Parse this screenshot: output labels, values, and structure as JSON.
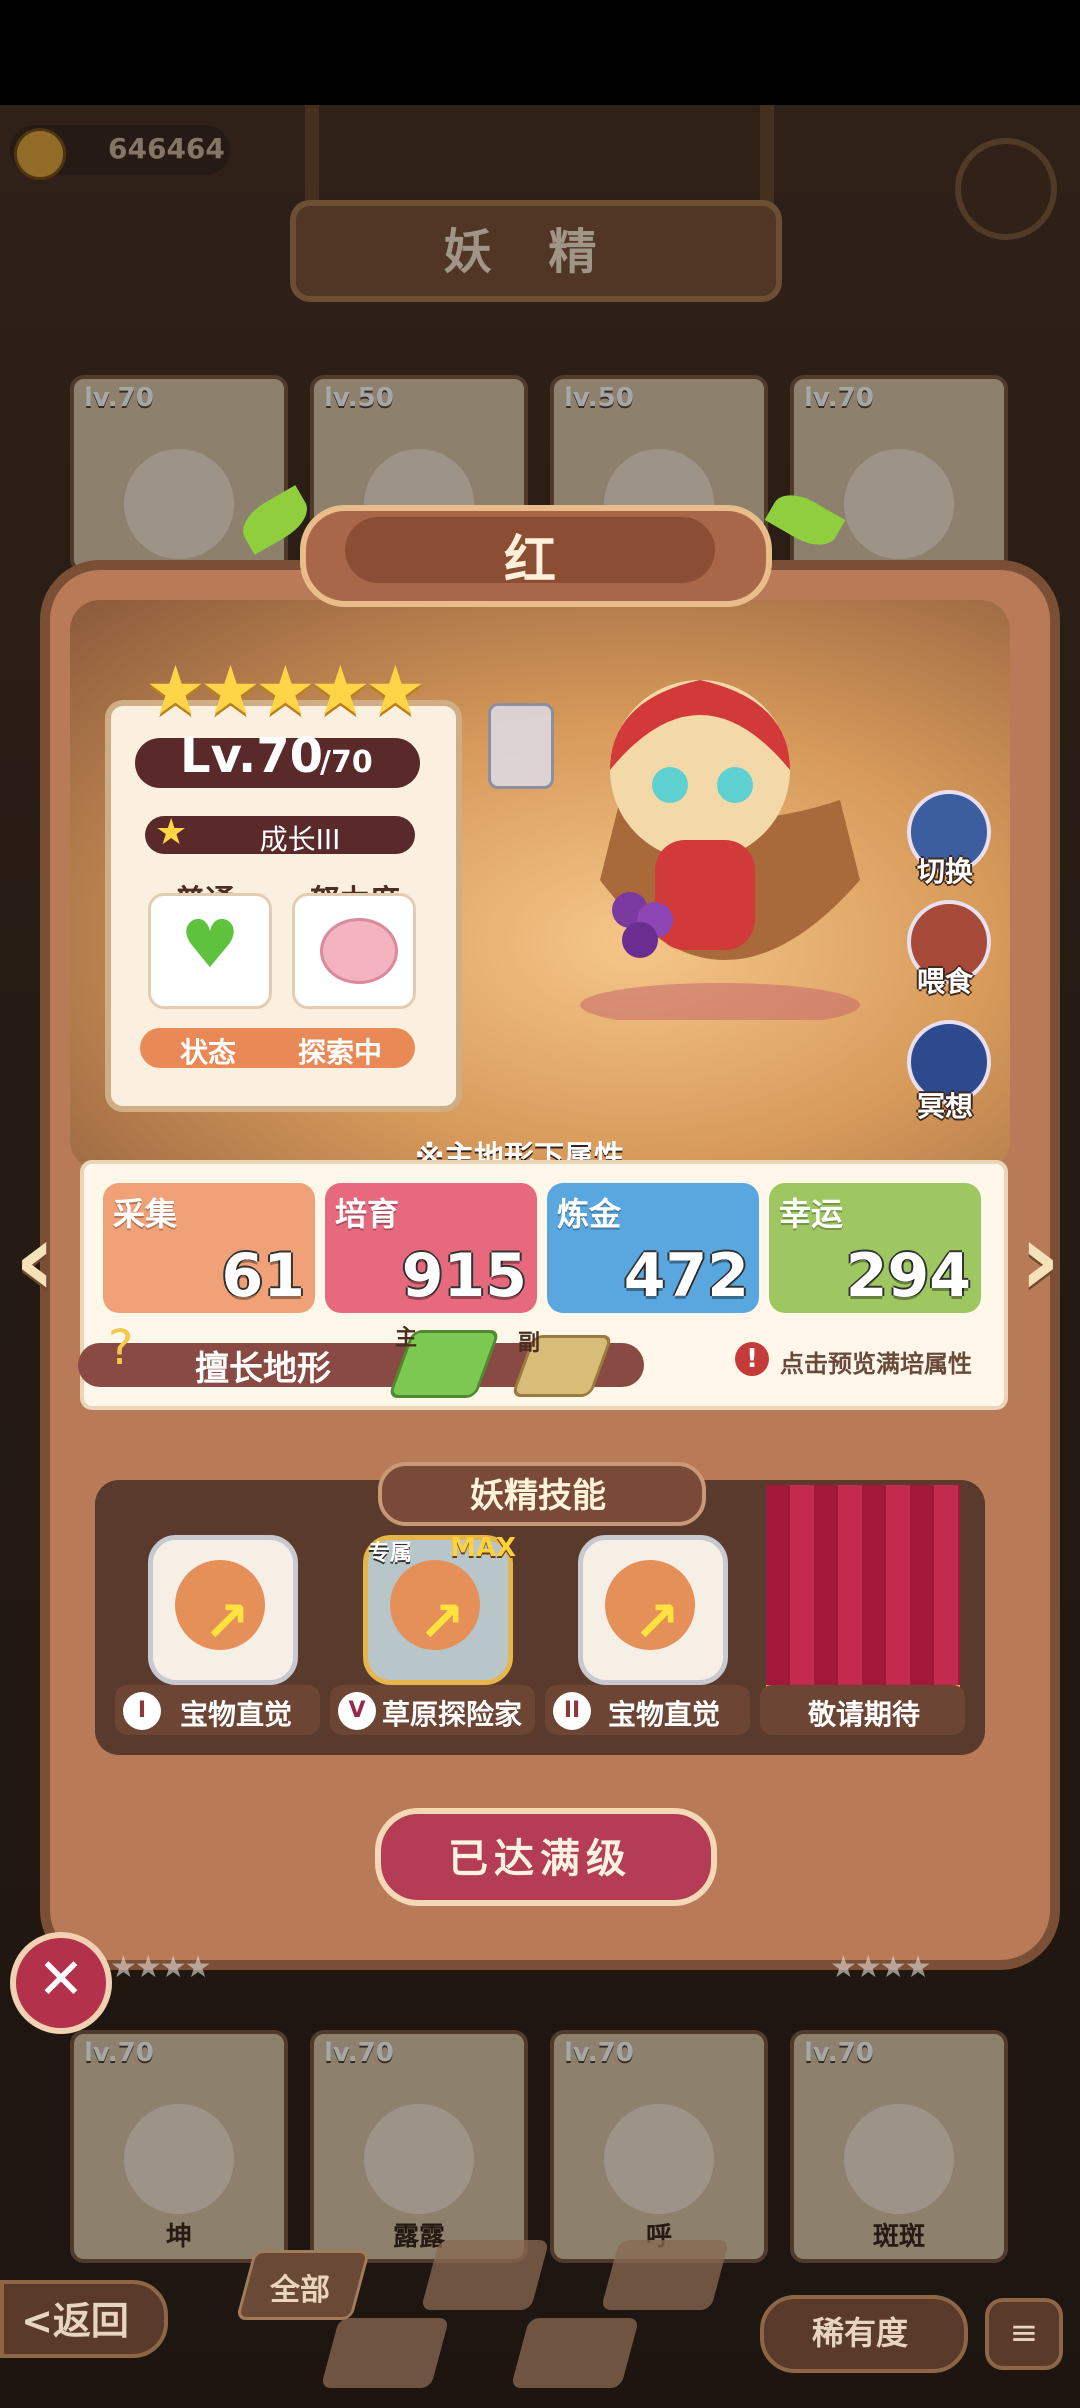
{
  "top": {
    "coin_count": "646464",
    "page_title": "妖 精"
  },
  "bg_cards_top": [
    {
      "level": "lv.70"
    },
    {
      "level": "lv.50"
    },
    {
      "level": "lv.50"
    },
    {
      "level": "lv.70"
    }
  ],
  "bg_cards_bottom": [
    {
      "level": "lv.70",
      "name": "坤"
    },
    {
      "level": "lv.70",
      "name": "露露"
    },
    {
      "level": "lv.70",
      "name": "呼"
    },
    {
      "level": "lv.70",
      "name": "斑斑"
    }
  ],
  "fairy": {
    "name": "红",
    "stars": "★★★★★",
    "level": "Lv.70",
    "level_max": "/70",
    "growth": "成长III",
    "mood_label": "普通",
    "effort_label": "努力度",
    "status_label": "状态",
    "status_value": "探索中"
  },
  "actions": {
    "switch": "切换",
    "feed": "喂食",
    "meditate": "冥想"
  },
  "attributes": {
    "title": "※主地形下属性",
    "items": [
      {
        "name": "采集",
        "value": "61",
        "color": "#f0a177"
      },
      {
        "name": "培育",
        "value": "915",
        "color": "#e6697e"
      },
      {
        "name": "炼金",
        "value": "472",
        "color": "#5aa6de"
      },
      {
        "name": "幸运",
        "value": "294",
        "color": "#9ec761"
      }
    ],
    "terrain_label": "擅长地形",
    "main_tag": "主",
    "sub_tag": "副",
    "preview_text": "点击预览满培属性"
  },
  "skills": {
    "title": "妖精技能",
    "items": [
      {
        "roman": "I",
        "name": "宝物直觉"
      },
      {
        "roman": "V",
        "name": "草原探险家",
        "tag": "专属",
        "badge": "MAX"
      },
      {
        "roman": "II",
        "name": "宝物直觉"
      },
      {
        "roman": "",
        "name": "敬请期待"
      }
    ]
  },
  "max_button": "已达满级",
  "close_icon": "✕",
  "bottom_nav": {
    "back": "<返回",
    "filter_all": "全部",
    "rarity": "稀有度",
    "sort_icon": "≡"
  }
}
